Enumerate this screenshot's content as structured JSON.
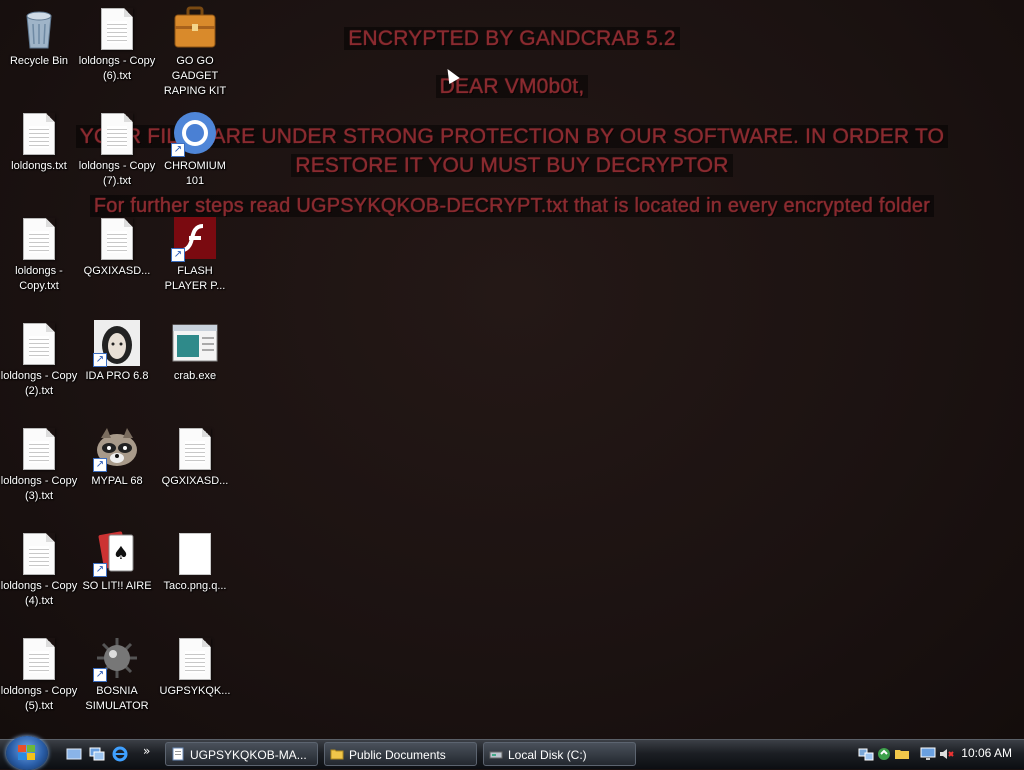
{
  "ransom_note": {
    "line1": "ENCRYPTED BY GANDCRAB 5.2",
    "line2": "DEAR VM0b0t,",
    "line3a": "YOUR FILES ARE UNDER STRONG PROTECTION BY OUR SOFTWARE. IN ORDER TO",
    "line3b": "RESTORE IT YOU MUST BUY DECRYPTOR",
    "line4": "For further steps read UGPSYKQKOB-DECRYPT.txt that is located in every encrypted folder"
  },
  "desktop_icons": {
    "recycle_bin": "Recycle Bin",
    "loldongs_copy6": "loldongs - Copy (6).txt",
    "gogo_gadget": "GO GO GADGET RAPING KIT",
    "loldongs": "loldongs.txt",
    "loldongs_copy7": "loldongs - Copy (7).txt",
    "chromium": "CHROMIUM 101",
    "loldongs_copy": "loldongs - Copy.txt",
    "qgxixasd1": "QGXIXASD...",
    "flash_player": "FLASH PLAYER P...",
    "loldongs_copy2": "loldongs - Copy (2).txt",
    "ida_pro": "IDA PRO 6.8",
    "crab_exe": "crab.exe",
    "loldongs_copy3": "loldongs - Copy (3).txt",
    "mypal": "MYPAL 68",
    "qgxixasd2": "QGXIXASD...",
    "loldongs_copy4": "loldongs - Copy (4).txt",
    "solitaire": "SO LIT!! AIRE",
    "taco": "Taco.png.q...",
    "loldongs_copy5": "loldongs - Copy (5).txt",
    "bosnia": "BOSNIA SIMULATOR",
    "ugpsykqk": "UGPSYKQK..."
  },
  "taskbar": {
    "quicklaunch_more": "»",
    "btn1": "UGPSYKQKOB-MA...",
    "btn2": "Public Documents",
    "btn3": "Local Disk (C:)",
    "clock": "10:06 AM"
  },
  "colors": {
    "ransom_text": "#8a2a2f",
    "desktop_bg": "#1b1211"
  }
}
